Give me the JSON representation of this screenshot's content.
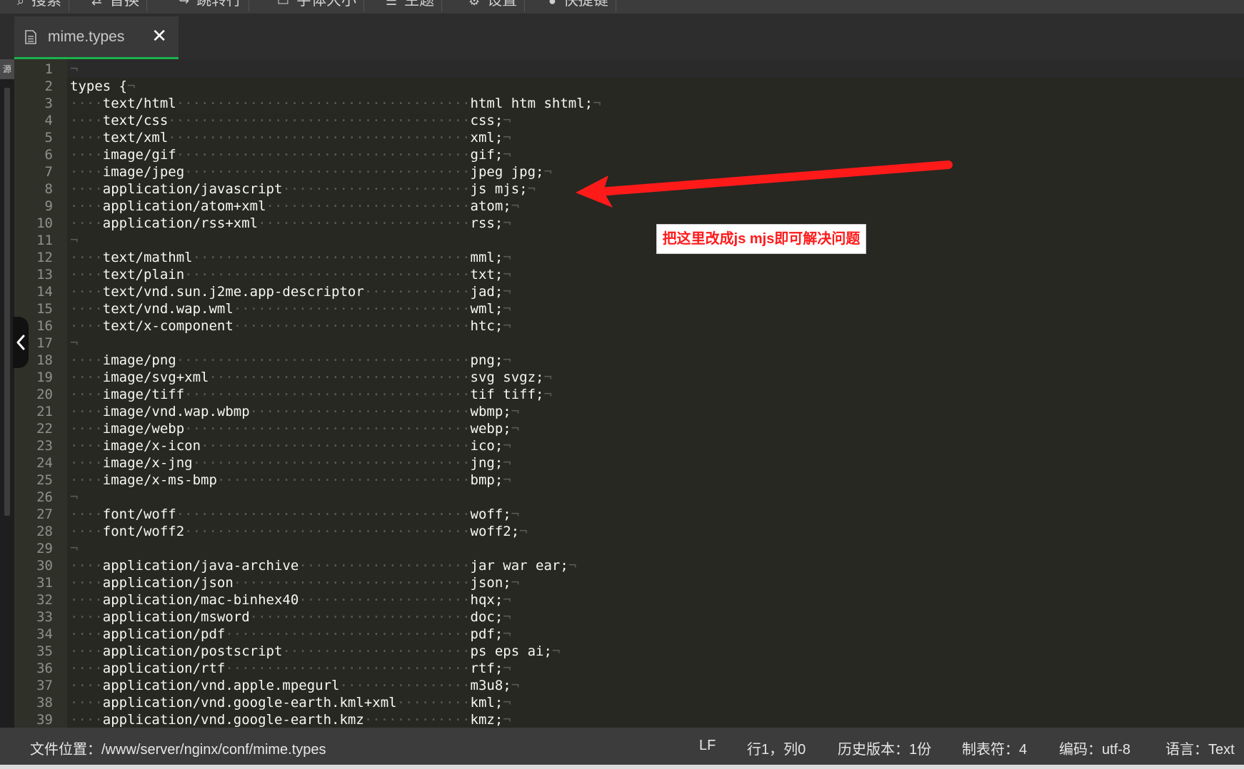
{
  "toolbar": {
    "items": [
      {
        "label": "搜索",
        "icon": "search-icon"
      },
      {
        "label": "替换",
        "icon": "replace-icon"
      },
      {
        "label": "跳转行",
        "icon": "goto-line-icon"
      },
      {
        "label": "字体大小",
        "icon": "font-size-icon"
      },
      {
        "label": "主题",
        "icon": "theme-icon"
      },
      {
        "label": "设置",
        "icon": "gear-icon"
      },
      {
        "label": "快捷键",
        "icon": "info-icon"
      }
    ]
  },
  "tab": {
    "title": "mime.types",
    "close": "✕"
  },
  "editor": {
    "lines": [
      {
        "n": "1",
        "k": "",
        "v": ""
      },
      {
        "n": "2",
        "k": "types {",
        "v": ""
      },
      {
        "n": "3",
        "k": "text/html",
        "v": "html htm shtml;"
      },
      {
        "n": "4",
        "k": "text/css",
        "v": "css;"
      },
      {
        "n": "5",
        "k": "text/xml",
        "v": "xml;"
      },
      {
        "n": "6",
        "k": "image/gif",
        "v": "gif;"
      },
      {
        "n": "7",
        "k": "image/jpeg",
        "v": "jpeg jpg;"
      },
      {
        "n": "8",
        "k": "application/javascript",
        "v": "js mjs;"
      },
      {
        "n": "9",
        "k": "application/atom+xml",
        "v": "atom;"
      },
      {
        "n": "10",
        "k": "application/rss+xml",
        "v": "rss;"
      },
      {
        "n": "11",
        "k": "",
        "v": ""
      },
      {
        "n": "12",
        "k": "text/mathml",
        "v": "mml;"
      },
      {
        "n": "13",
        "k": "text/plain",
        "v": "txt;"
      },
      {
        "n": "14",
        "k": "text/vnd.sun.j2me.app-descriptor",
        "v": "jad;"
      },
      {
        "n": "15",
        "k": "text/vnd.wap.wml",
        "v": "wml;"
      },
      {
        "n": "16",
        "k": "text/x-component",
        "v": "htc;"
      },
      {
        "n": "17",
        "k": "",
        "v": ""
      },
      {
        "n": "18",
        "k": "image/png",
        "v": "png;"
      },
      {
        "n": "19",
        "k": "image/svg+xml",
        "v": "svg svgz;"
      },
      {
        "n": "20",
        "k": "image/tiff",
        "v": "tif tiff;"
      },
      {
        "n": "21",
        "k": "image/vnd.wap.wbmp",
        "v": "wbmp;"
      },
      {
        "n": "22",
        "k": "image/webp",
        "v": "webp;"
      },
      {
        "n": "23",
        "k": "image/x-icon",
        "v": "ico;"
      },
      {
        "n": "24",
        "k": "image/x-jng",
        "v": "jng;"
      },
      {
        "n": "25",
        "k": "image/x-ms-bmp",
        "v": "bmp;"
      },
      {
        "n": "26",
        "k": "",
        "v": ""
      },
      {
        "n": "27",
        "k": "font/woff",
        "v": "woff;"
      },
      {
        "n": "28",
        "k": "font/woff2",
        "v": "woff2;"
      },
      {
        "n": "29",
        "k": "",
        "v": ""
      },
      {
        "n": "30",
        "k": "application/java-archive",
        "v": "jar war ear;"
      },
      {
        "n": "31",
        "k": "application/json",
        "v": "json;"
      },
      {
        "n": "32",
        "k": "application/mac-binhex40",
        "v": "hqx;"
      },
      {
        "n": "33",
        "k": "application/msword",
        "v": "doc;"
      },
      {
        "n": "34",
        "k": "application/pdf",
        "v": "pdf;"
      },
      {
        "n": "35",
        "k": "application/postscript",
        "v": "ps eps ai;"
      },
      {
        "n": "36",
        "k": "application/rtf",
        "v": "rtf;"
      },
      {
        "n": "37",
        "k": "application/vnd.apple.mpegurl",
        "v": "m3u8;"
      },
      {
        "n": "38",
        "k": "application/vnd.google-earth.kml+xml",
        "v": "kml;"
      },
      {
        "n": "39",
        "k": "application/vnd.google-earth.kmz",
        "v": "kmz;"
      }
    ]
  },
  "annotation": {
    "text": "把这里改成js mjs即可解决问题",
    "color": "#ff1a1a"
  },
  "status": {
    "path": "文件位置：/www/server/nginx/conf/mime.types",
    "eol": "LF",
    "cursor": "行1，列0",
    "history": "历史版本：1份",
    "tab": "制表符：4",
    "encoding": "编码：utf-8",
    "language": "语言：Text"
  },
  "sidebar": {
    "label": "源"
  }
}
